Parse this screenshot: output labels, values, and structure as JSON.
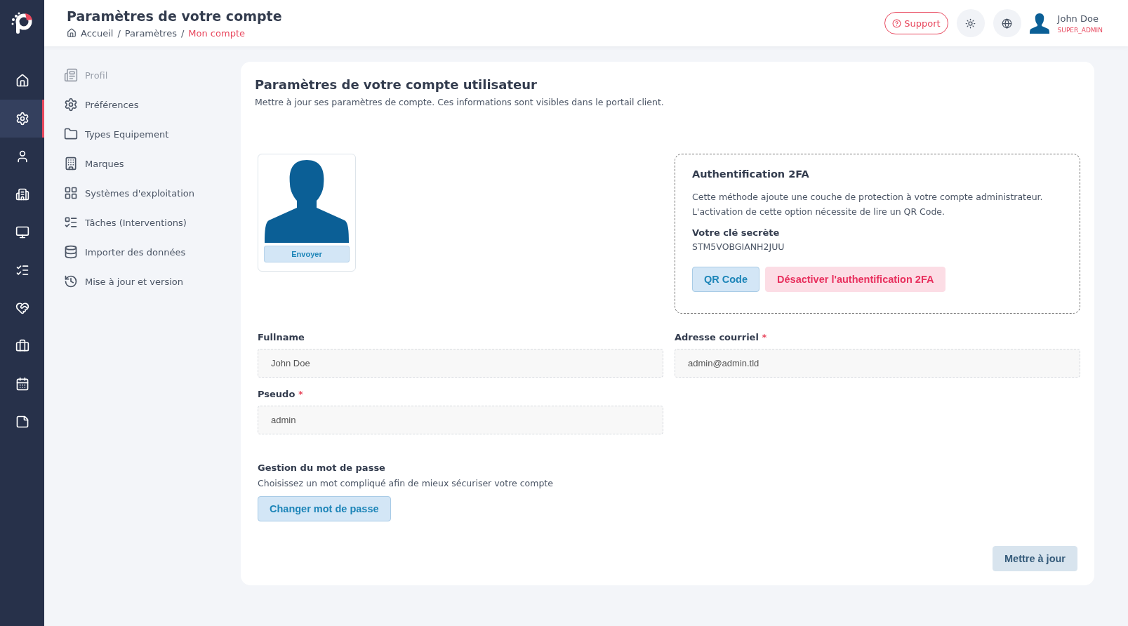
{
  "header": {
    "title": "Paramètres de votre compte",
    "breadcrumb": [
      {
        "label": "Accueil",
        "current": false
      },
      {
        "separator": "/",
        "label": "Paramètres",
        "current": false
      },
      {
        "separator": "/",
        "label": "Mon compte",
        "current": true
      }
    ],
    "support": "Support",
    "user": {
      "name": "John Doe",
      "role": "SUPER_ADMIN"
    }
  },
  "rail": [
    {
      "selected": false
    },
    {
      "selected": true
    },
    {
      "selected": false
    },
    {
      "selected": false
    },
    {
      "selected": false
    },
    {
      "selected": false
    },
    {
      "selected": false
    },
    {
      "selected": false
    },
    {
      "selected": false
    },
    {
      "selected": false
    }
  ],
  "settings_menu": [
    {
      "label": "Profil",
      "selected": true
    },
    {
      "label": "Préférences",
      "selected": false
    },
    {
      "label": "Types Equipement",
      "selected": false
    },
    {
      "label": "Marques",
      "selected": false
    },
    {
      "label": "Systèmes d'exploitation",
      "selected": false
    },
    {
      "label": "Tâches (Interventions)",
      "selected": false
    },
    {
      "label": "Importer des données",
      "selected": false
    },
    {
      "label": "Mise à jour et version",
      "selected": false
    }
  ],
  "card": {
    "title": "Paramètres de votre compte utilisateur",
    "subtitle": "Mettre à jour ses paramètres de compte. Ces informations sont visibles dans le portail client.",
    "avatar": {
      "button": "Envoyer"
    },
    "twofa": {
      "title": "Authentification 2FA",
      "description": [
        "Cette méthode ajoute une couche de protection à votre compte administrateur.",
        "L'activation de cette option nécessite de lire un QR Code."
      ],
      "secret_label": "Votre clé secrète",
      "secret": "STM5VOBGIANH2JUU",
      "qr_button": "QR Code",
      "disable_button": "Désactiver l'authentification 2FA"
    },
    "fields": [
      {
        "label": "Fullname",
        "value": "John Doe"
      },
      {
        "label": "Adresse courriel",
        "required_mark": "*",
        "value": "admin@admin.tld"
      },
      {
        "label": "Pseudo",
        "required_mark": "*",
        "value": "admin"
      }
    ],
    "password": {
      "title": "Gestion du mot de passe",
      "hint": "Choisissez un mot compliqué afin de mieux sécuriser votre compte",
      "button": "Changer mot de passe"
    },
    "submit": "Mettre à jour"
  }
}
